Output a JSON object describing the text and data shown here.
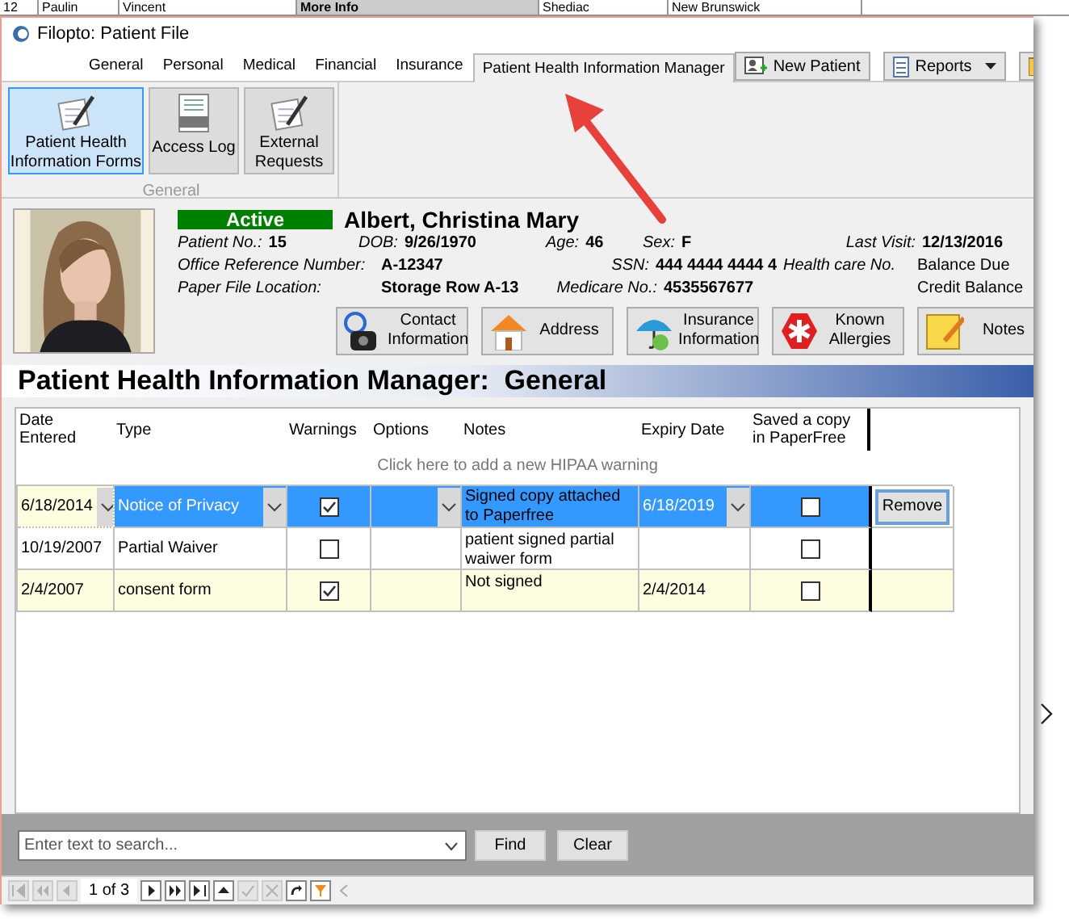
{
  "background_sheet": {
    "cells": [
      "12",
      "Paulin",
      "Vincent",
      "More Info",
      "Shediac",
      "New Brunswick"
    ]
  },
  "window": {
    "title": "Filopto: Patient File"
  },
  "tabs": [
    {
      "label": "General",
      "selected": false
    },
    {
      "label": "Personal",
      "selected": false
    },
    {
      "label": "Medical",
      "selected": false
    },
    {
      "label": "Financial",
      "selected": false
    },
    {
      "label": "Insurance",
      "selected": false
    },
    {
      "label": "Patient Health Information Manager",
      "selected": true
    }
  ],
  "toolbar_buttons": [
    {
      "label": "New Patient",
      "kind": "button"
    },
    {
      "label": "Reports",
      "kind": "dropdown"
    },
    {
      "kind": "clipped"
    }
  ],
  "ribbon": {
    "group_label": "General",
    "buttons": [
      {
        "label": "Patient Health Information Forms",
        "kind": "forms",
        "selected": true
      },
      {
        "label": "Access Log",
        "kind": "log",
        "selected": false
      },
      {
        "label": "External Requests",
        "kind": "forms",
        "selected": false
      }
    ]
  },
  "patient": {
    "status": "Active",
    "name": "Albert, Christina Mary",
    "field_rows": [
      [
        {
          "label": "Patient No.:",
          "value": "15"
        },
        {
          "label": "DOB:",
          "value": "9/26/1970"
        },
        {
          "label": "Age:",
          "value": "46"
        },
        {
          "label": "Sex:",
          "value": "F"
        },
        {
          "label": "Last Visit:",
          "value": "12/13/2016"
        }
      ],
      [
        {
          "label": "Office Reference Number:",
          "value": "A-12347"
        },
        {
          "label": "SSN:",
          "value": "444 4444 4444 4"
        },
        {
          "label": "Health care No."
        },
        {
          "value": "Balance Due"
        }
      ],
      [
        {
          "label": "Paper File Location:",
          "value": "Storage Row A-13"
        },
        {
          "label": "Medicare No.:",
          "value": "4535567677"
        },
        {
          "value": "Credit Balance"
        }
      ]
    ],
    "buttons": [
      {
        "label": "Contact Information",
        "kind": "contact"
      },
      {
        "label": "Address",
        "kind": "address"
      },
      {
        "label": "Insurance Information",
        "kind": "insurance"
      },
      {
        "label": "Known Allergies",
        "kind": "allergies"
      },
      {
        "label": "Notes",
        "kind": "notes"
      }
    ]
  },
  "section_title": "Patient Health Information Manager:  General",
  "table": {
    "columns": [
      "Date Entered",
      "Type",
      "Warnings",
      "Options",
      "Notes",
      "Expiry Date",
      "Saved a copy in PaperFree"
    ],
    "add_hint": "Click here to add a new HIPAA warning",
    "rows": [
      {
        "selected": true,
        "date": "6/18/2014",
        "type": "Notice of Privacy",
        "warnings": true,
        "notes": "Signed copy attached to Paperfree",
        "expiry": "6/18/2019",
        "saved": false,
        "button": "Remove"
      },
      {
        "selected": false,
        "date": "10/19/2007",
        "type": "Partial Waiver",
        "warnings": false,
        "notes": "patient signed partial waiwer form",
        "saved": false
      },
      {
        "selected": false,
        "date": "2/4/2007",
        "type": "consent form",
        "warnings": true,
        "notes": "Not signed",
        "expiry": "2/4/2014",
        "saved": false
      }
    ]
  },
  "search": {
    "placeholder": "Enter text to search...",
    "buttons": [
      "Find",
      "Clear"
    ]
  },
  "navigator": {
    "position": "1 of 3"
  }
}
